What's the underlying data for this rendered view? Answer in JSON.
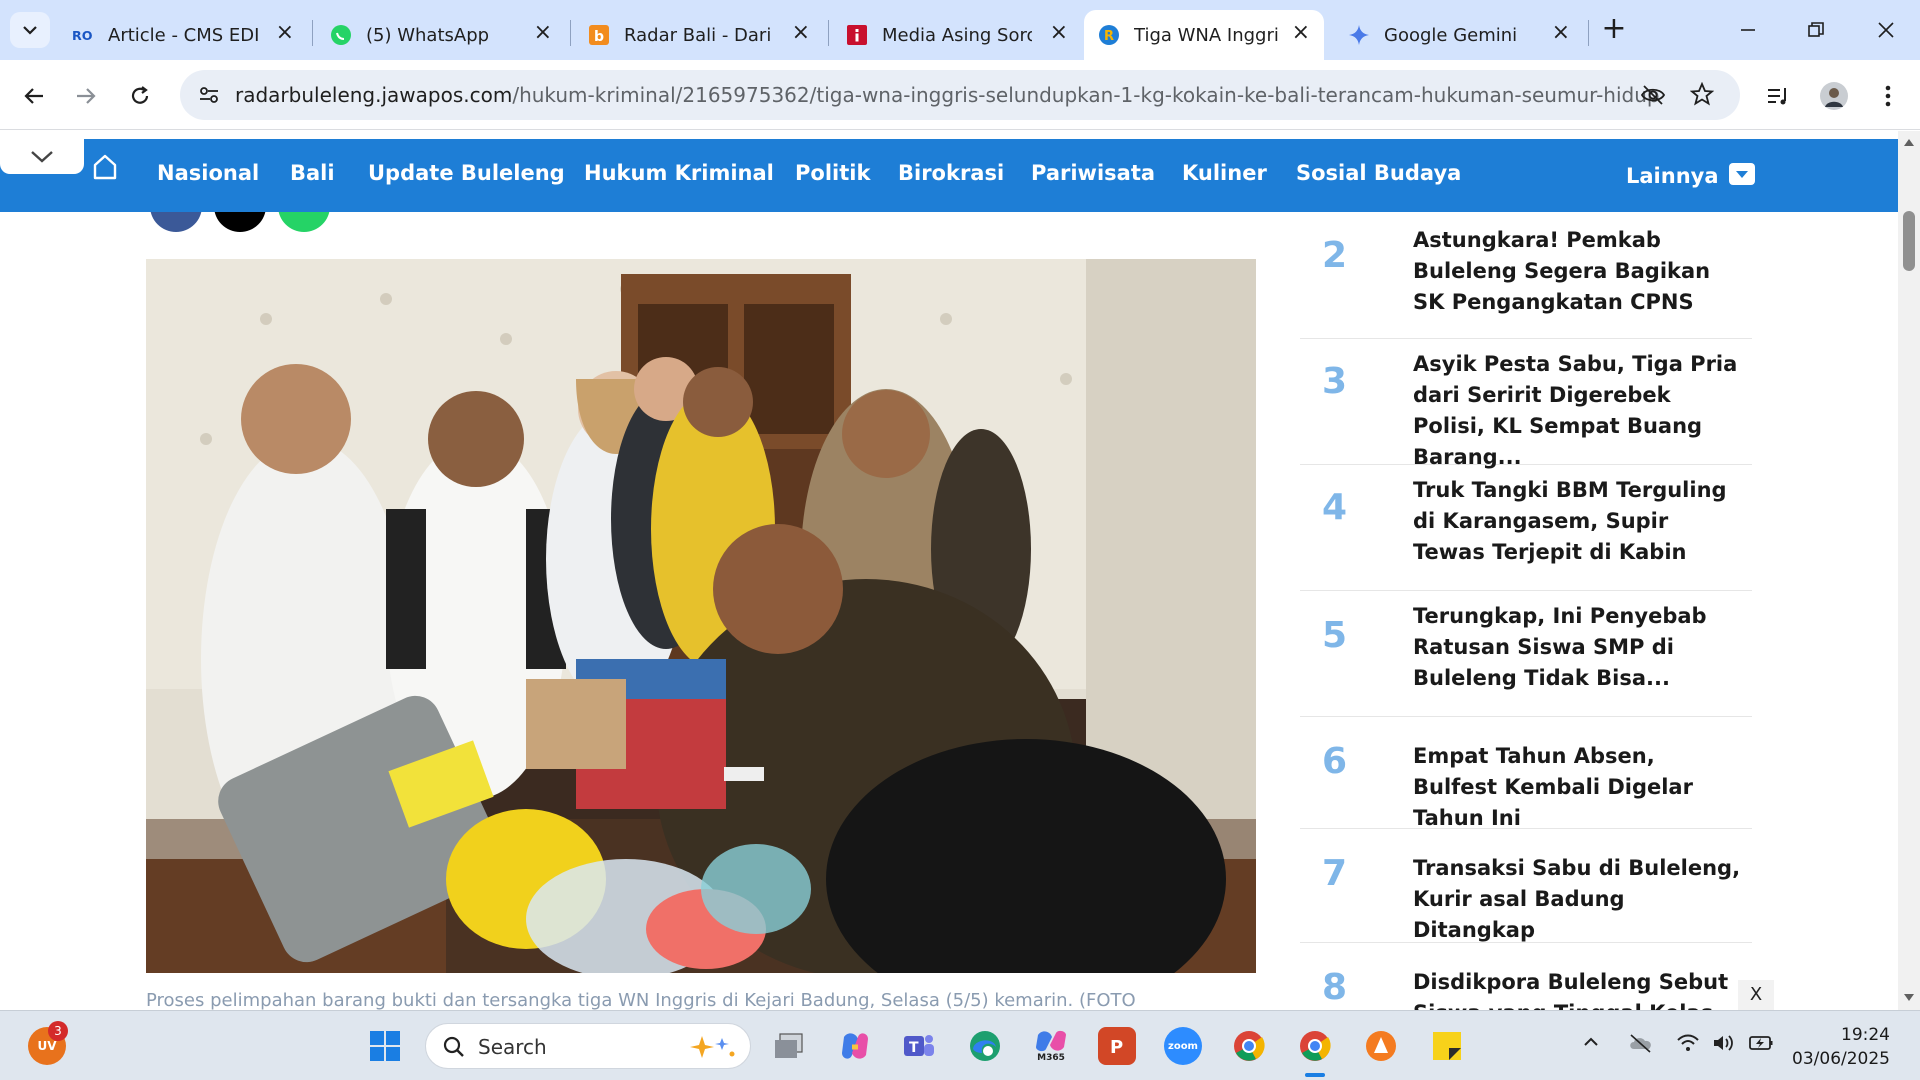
{
  "browser": {
    "tabs": [
      {
        "title": "Article - CMS EDITOR",
        "favicon": "ro-icon",
        "active": false
      },
      {
        "title": "(5) WhatsApp",
        "favicon": "whatsapp-icon",
        "active": false
      },
      {
        "title": "Radar Bali - Dari Bali",
        "favicon": "radar-bali-icon",
        "active": false
      },
      {
        "title": "Media Asing Sorot",
        "favicon": "info-icon",
        "active": false
      },
      {
        "title": "Tiga WNA Inggris Selundupkan",
        "favicon": "radar-buleleng-icon",
        "active": true
      },
      {
        "title": "Google Gemini",
        "favicon": "gemini-icon",
        "active": false
      }
    ],
    "url_host": "radarbuleleng.jawapos.com",
    "url_path": "/hukum-kriminal/2165975362/tiga-wna-inggris-selundupkan-1-kg-kokain-ke-bali-terancam-hukuman-seumur-hidup"
  },
  "site": {
    "nav": [
      "Nasional",
      "Bali",
      "Update Buleleng",
      "Hukum Kriminal",
      "Politik",
      "Birokrasi",
      "Pariwisata",
      "Kuliner",
      "Sosial Budaya"
    ],
    "nav_more": "Lainnya",
    "caption": "Proses pelimpahan barang bukti dan tersangka tiga WN Inggris di Kejari Badung, Selasa (5/5) kemarin. (FOTO",
    "popular": [
      {
        "rank": "2",
        "title": "Astungkara! Pemkab Buleleng Segera Bagikan SK Pengangkatan CPNS"
      },
      {
        "rank": "3",
        "title": "Asyik Pesta Sabu, Tiga Pria dari Seririt Digerebek Polisi, KL Sempat Buang Barang..."
      },
      {
        "rank": "4",
        "title": "Truk Tangki BBM Terguling di Karangasem, Supir Tewas Terjepit di Kabin"
      },
      {
        "rank": "5",
        "title": "Terungkap, Ini Penyebab Ratusan Siswa SMP di Buleleng Tidak Bisa..."
      },
      {
        "rank": "6",
        "title": "Empat Tahun Absen, Bulfest Kembali Digelar Tahun Ini"
      },
      {
        "rank": "7",
        "title": "Transaksi Sabu di Buleleng, Kurir asal Badung Ditangkap"
      },
      {
        "rank": "8",
        "title": "Disdikpora Buleleng Sebut Siswa yang Tinggal Kelas"
      }
    ],
    "ad_close": "X"
  },
  "taskbar": {
    "search_placeholder": "Search",
    "profile_initials": "UV",
    "notification_count": "3",
    "time": "19:24",
    "date": "03/06/2025",
    "zoom_label": "zoom",
    "m365_label": "M365"
  },
  "colors": {
    "nav_blue": "#1e7ed6",
    "rank_blue": "#7fb6e8",
    "tabstrip": "#d3e3fd"
  }
}
